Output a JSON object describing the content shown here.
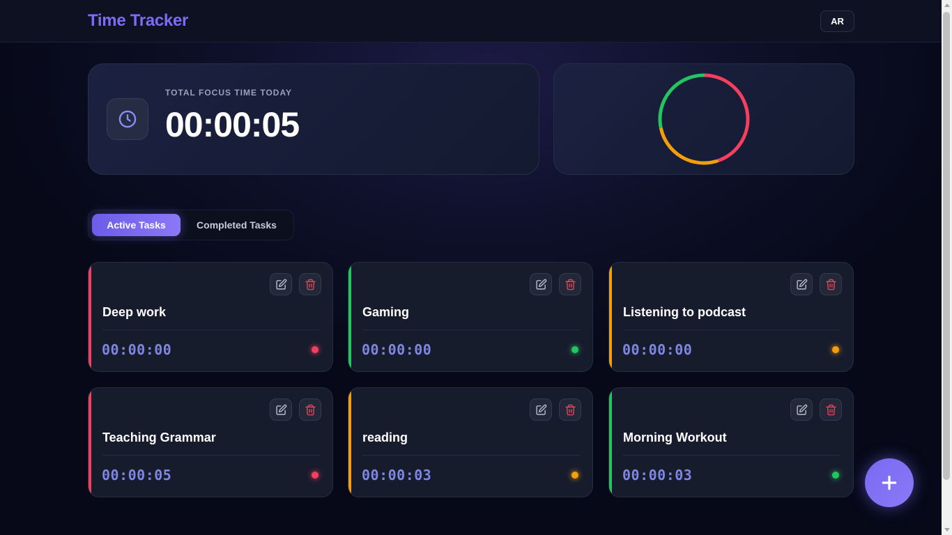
{
  "header": {
    "brand": "Time Tracker",
    "avatar_initials": "AR"
  },
  "focus": {
    "label": "TOTAL FOCUS TIME TODAY",
    "time": "00:00:05",
    "icon": "clock-icon"
  },
  "chart_data": {
    "type": "pie",
    "style": "donut",
    "segments": [
      {
        "color": "#f43f5e",
        "value": 45
      },
      {
        "color": "#f59e0b",
        "value": 27
      },
      {
        "color": "#22c55e",
        "value": 28
      }
    ]
  },
  "tabs": [
    {
      "label": "Active Tasks",
      "active": true
    },
    {
      "label": "Completed Tasks",
      "active": false
    }
  ],
  "icons": {
    "edit": "edit-icon",
    "delete": "trash-icon",
    "add": "plus-icon"
  },
  "colors": {
    "accent": "#7b6cf6",
    "red": "#f43f5e",
    "green": "#22c55e",
    "orange": "#f59e0b",
    "delete": "#e0455c",
    "timer": "#7f86e0"
  },
  "tasks": [
    {
      "name": "Deep work",
      "time": "00:00:00",
      "color": "#f43f5e"
    },
    {
      "name": "Gaming",
      "time": "00:00:00",
      "color": "#22c55e"
    },
    {
      "name": "Listening to podcast",
      "time": "00:00:00",
      "color": "#f59e0b"
    },
    {
      "name": "Teaching Grammar",
      "time": "00:00:05",
      "color": "#f43f5e"
    },
    {
      "name": "reading",
      "time": "00:00:03",
      "color": "#f59e0b"
    },
    {
      "name": "Morning Workout",
      "time": "00:00:03",
      "color": "#22c55e"
    }
  ]
}
